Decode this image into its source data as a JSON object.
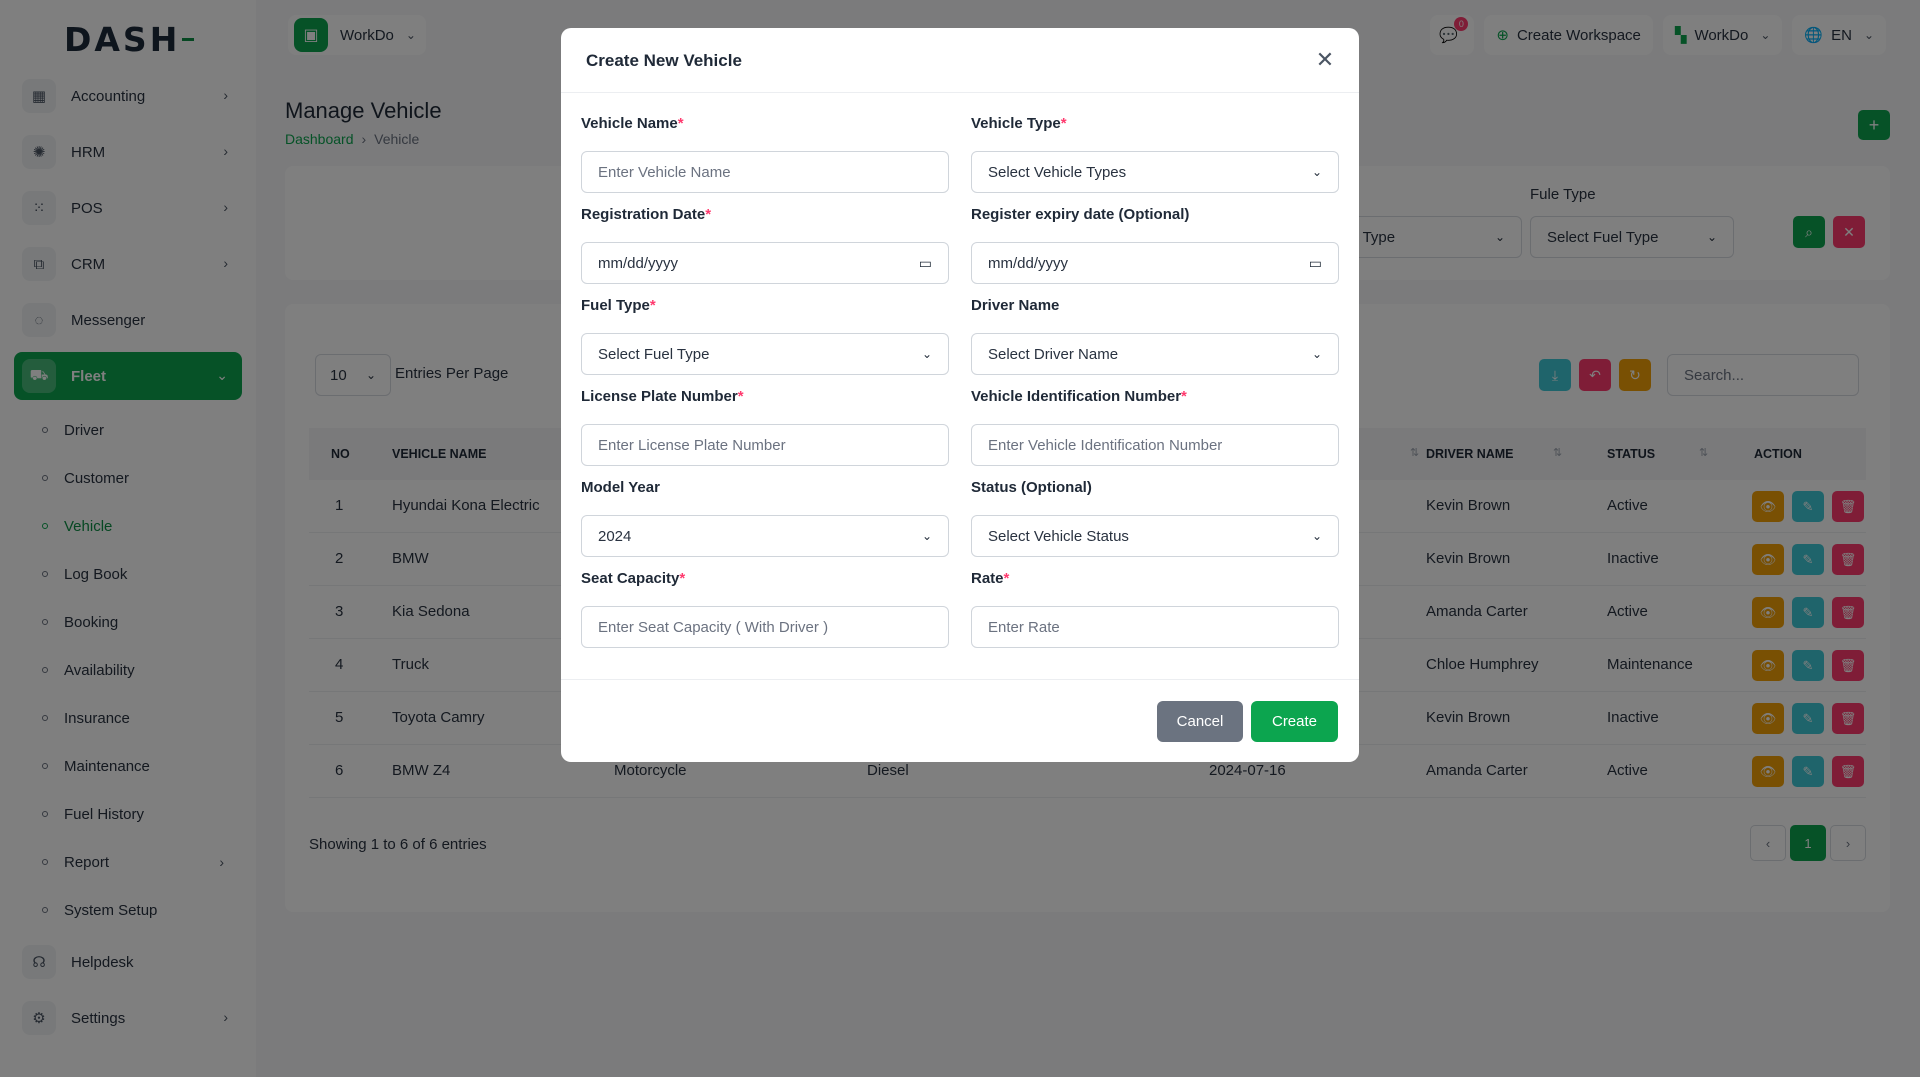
{
  "logo": "DASH",
  "sidebar": {
    "items": [
      {
        "label": "Accounting",
        "icon": "accounting-icon",
        "glyph": "▦",
        "chevron": "›"
      },
      {
        "label": "HRM",
        "icon": "hrm-icon",
        "glyph": "✺",
        "chevron": "›"
      },
      {
        "label": "POS",
        "icon": "pos-icon",
        "glyph": "⁙",
        "chevron": "›"
      },
      {
        "label": "CRM",
        "icon": "crm-icon",
        "glyph": "⧉",
        "chevron": "›"
      },
      {
        "label": "Messenger",
        "icon": "messenger-icon",
        "glyph": "◌",
        "chevron": ""
      },
      {
        "label": "Fleet",
        "icon": "fleet-icon",
        "glyph": "⛟",
        "chevron": "⌄"
      }
    ],
    "fleet_sub": [
      "Driver",
      "Customer",
      "Vehicle",
      "Log Book",
      "Booking",
      "Availability",
      "Insurance",
      "Maintenance",
      "Fuel History",
      "Report",
      "System Setup"
    ],
    "bottom": [
      {
        "label": "Helpdesk",
        "icon": "helpdesk-icon",
        "glyph": "☊",
        "chevron": ""
      },
      {
        "label": "Settings",
        "icon": "settings-icon",
        "glyph": "⚙",
        "chevron": "›"
      }
    ]
  },
  "topbar": {
    "workspace": "WorkDo",
    "message_badge": "0",
    "create_workspace": "Create Workspace",
    "workspace_menu": "WorkDo",
    "language": "EN"
  },
  "page": {
    "title": "Manage Vehicle",
    "breadcrumb": {
      "home": "Dashboard",
      "sep": "›",
      "current": "Vehicle"
    }
  },
  "filter": {
    "vehicle_type_value": "le Type",
    "fuel_label": "Fule Type",
    "fuel_value": "Select Fuel Type"
  },
  "table": {
    "per_page": "10",
    "per_page_label": "Entries Per Page",
    "search_placeholder": "Search...",
    "headers": {
      "no": "NO",
      "vehicle": "VEHICLE NAME",
      "driver": "DRIVER NAME",
      "status": "STATUS",
      "action": "ACTION"
    },
    "rows": [
      {
        "no": "1",
        "vehicle": "Hyundai Kona Electric",
        "type": "",
        "fuel": "",
        "date": "",
        "driver": "Kevin Brown",
        "status": "Active"
      },
      {
        "no": "2",
        "vehicle": "BMW",
        "type": "",
        "fuel": "",
        "date": "",
        "driver": "Kevin Brown",
        "status": "Inactive"
      },
      {
        "no": "3",
        "vehicle": "Kia Sedona",
        "type": "",
        "fuel": "",
        "date": "",
        "driver": "Amanda Carter",
        "status": "Active"
      },
      {
        "no": "4",
        "vehicle": "Truck",
        "type": "",
        "fuel": "",
        "date": "",
        "driver": "Chloe Humphrey",
        "status": "Maintenance"
      },
      {
        "no": "5",
        "vehicle": "Toyota Camry",
        "type": "",
        "fuel": "",
        "date": "",
        "driver": "Kevin Brown",
        "status": "Inactive"
      },
      {
        "no": "6",
        "vehicle": "BMW Z4",
        "type": "Motorcycle",
        "fuel": "Diesel",
        "date": "2024-07-16",
        "driver": "Amanda Carter",
        "status": "Active"
      }
    ],
    "showing": "Showing 1 to 6 of 6 entries",
    "page": "1"
  },
  "modal": {
    "title": "Create New Vehicle",
    "fields": {
      "vehicle_name": {
        "label": "Vehicle Name",
        "placeholder": "Enter Vehicle Name"
      },
      "vehicle_type": {
        "label": "Vehicle Type",
        "value": "Select Vehicle Types"
      },
      "registration_date": {
        "label": "Registration Date",
        "value": "mm/dd/yyyy"
      },
      "expiry_date": {
        "label": "Register expiry date (Optional)",
        "value": "mm/dd/yyyy"
      },
      "fuel_type": {
        "label": "Fuel Type",
        "value": "Select Fuel Type"
      },
      "driver_name": {
        "label": "Driver Name",
        "value": "Select Driver Name"
      },
      "license_plate": {
        "label": "License Plate Number",
        "placeholder": "Enter License Plate Number"
      },
      "vin": {
        "label": "Vehicle Identification Number",
        "placeholder": "Enter Vehicle Identification Number"
      },
      "model_year": {
        "label": "Model Year",
        "value": "2024"
      },
      "status": {
        "label": "Status (Optional)",
        "value": "Select Vehicle Status"
      },
      "seat_capacity": {
        "label": "Seat Capacity",
        "placeholder": "Enter Seat Capacity ( With Driver )"
      },
      "rate": {
        "label": "Rate",
        "placeholder": "Enter Rate"
      }
    },
    "required_mark": "*",
    "cancel": "Cancel",
    "create": "Create"
  },
  "colors": {
    "accent": "#0ca54f",
    "view": "#f2a007",
    "edit": "#3ec9d6",
    "delete": "#ff3a6e",
    "cancel": "#6b7380"
  }
}
